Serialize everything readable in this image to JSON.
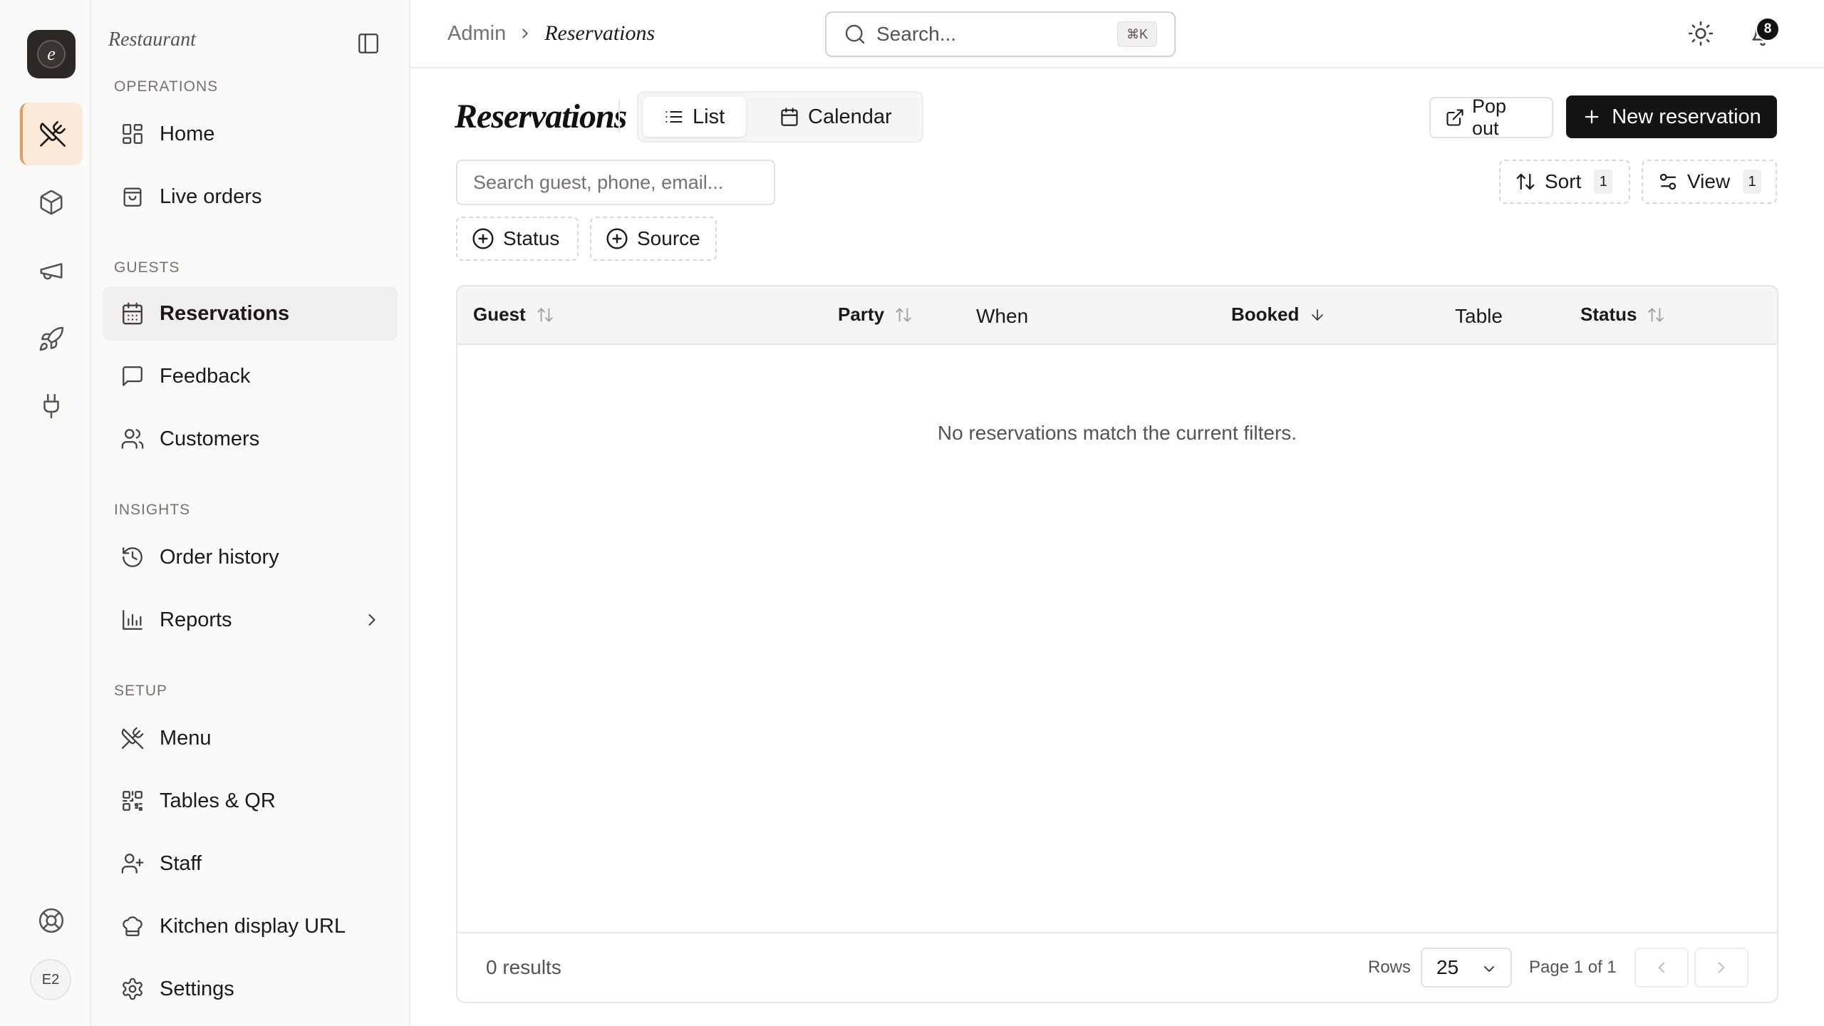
{
  "rail": {
    "logo_letter": "e",
    "items": [
      "utensils-crossed",
      "package",
      "megaphone",
      "rocket",
      "plug"
    ],
    "help": "life-buoy",
    "avatar": "E2"
  },
  "sidebar": {
    "brand": "Restaurant",
    "sections": {
      "operations": "OPERATIONS",
      "guests": "GUESTS",
      "insights": "INSIGHTS",
      "setup": "SETUP"
    },
    "items": {
      "home": "Home",
      "live_orders": "Live orders",
      "reservations": "Reservations",
      "feedback": "Feedback",
      "customers": "Customers",
      "order_history": "Order history",
      "reports": "Reports",
      "menu": "Menu",
      "tables_qr": "Tables & QR",
      "staff": "Staff",
      "kitchen_display": "Kitchen display URL",
      "settings": "Settings"
    },
    "active": "Reservations"
  },
  "header": {
    "breadcrumb": {
      "root": "Admin",
      "current": "Reservations"
    },
    "search": {
      "placeholder": "Search...",
      "shortcut": "⌘K"
    },
    "notifications_count": "8"
  },
  "main": {
    "title": "Reservations",
    "view_tabs": {
      "list": "List",
      "calendar": "Calendar",
      "selected": "List"
    },
    "pop_out": "Pop out",
    "new_reservation": "New reservation",
    "filter_placeholder": "Search guest, phone, email...",
    "sort": {
      "label": "Sort",
      "count": "1"
    },
    "view": {
      "label": "View",
      "count": "1"
    },
    "facets": {
      "status": "Status",
      "source": "Source"
    },
    "table": {
      "columns": {
        "guest": "Guest",
        "party": "Party",
        "when": "When",
        "booked": "Booked",
        "table": "Table",
        "status": "Status"
      },
      "empty_message": "No reservations match the current filters.",
      "results": "0 results",
      "rows_label": "Rows",
      "rows_value": "25",
      "page_label": "Page 1 of 1"
    }
  },
  "colors": {
    "accent_active_bg": "#fbe9da",
    "accent_active_border": "#e39a5e",
    "primary_button": "#141414"
  }
}
